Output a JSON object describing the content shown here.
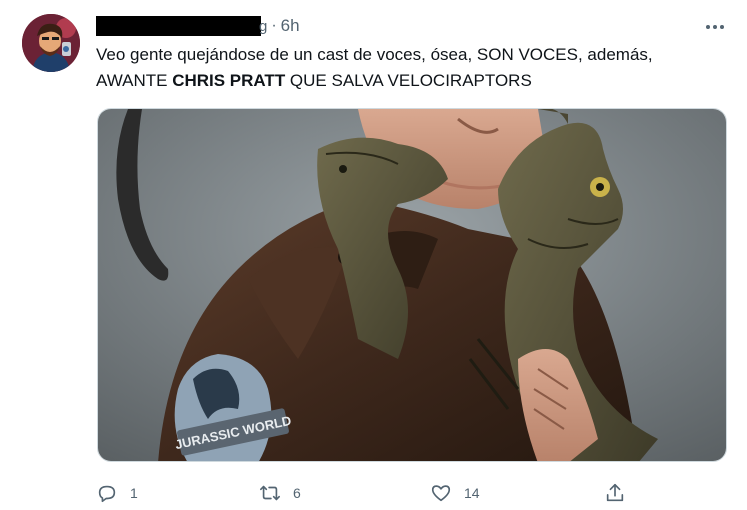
{
  "tweet": {
    "author_tail": "g",
    "separator": "·",
    "time": "6h",
    "text_line1": "Veo gente quejándose de un cast de voces, ósea, SON VOCES, además,",
    "text_line2_prefix": "AWANTE ",
    "text_line2_bold": "CHRIS PRATT",
    "text_line2_suffix": " QUE SALVA VELOCIRAPTORS",
    "patch_text": "JURASSIC WORLD"
  },
  "actions": {
    "reply_count": "1",
    "retweet_count": "6",
    "like_count": "14"
  },
  "icons": {
    "more": "more-horizontal-icon",
    "reply": "reply-icon",
    "retweet": "retweet-icon",
    "like": "heart-icon",
    "share": "share-icon"
  },
  "colors": {
    "secondary_text": "#536471",
    "primary_text": "#0f1419",
    "media_border": "#cfd9de"
  }
}
